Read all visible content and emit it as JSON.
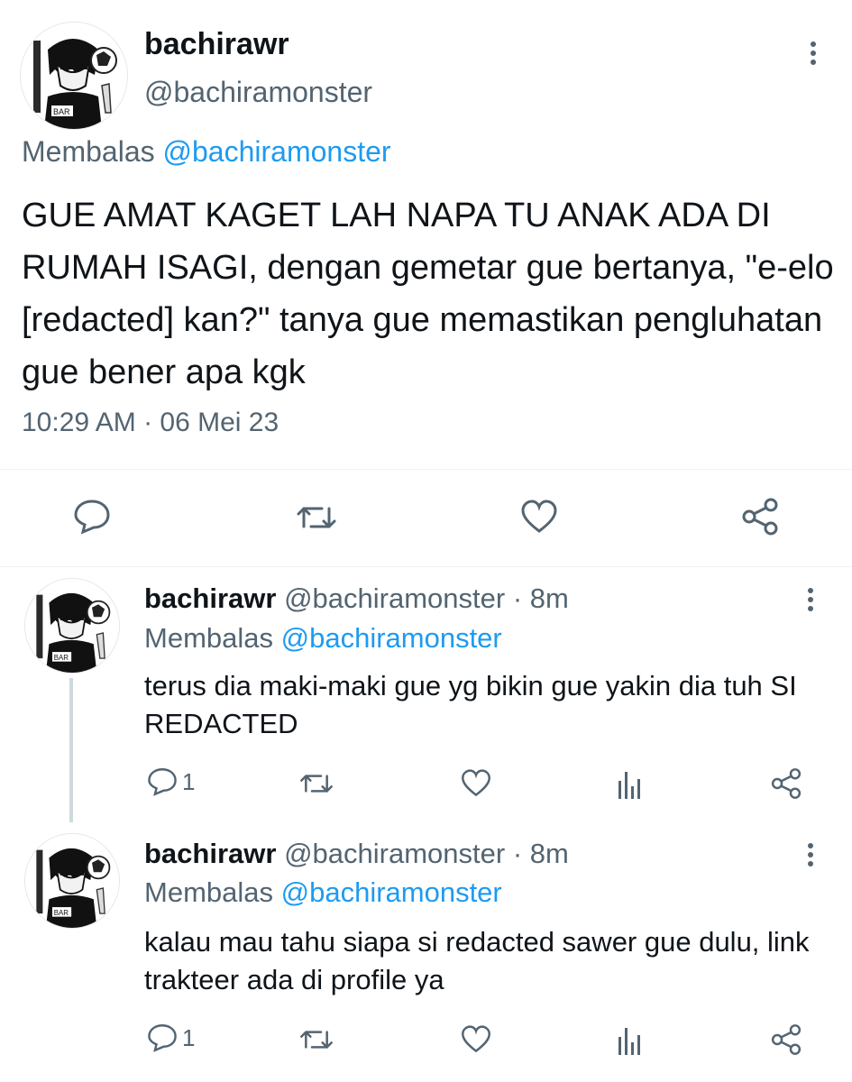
{
  "main_tweet": {
    "display_name": "bachirawr",
    "handle": "@bachiramonster",
    "reply_prefix": "Membalas",
    "reply_to": "@bachiramonster",
    "text": "GUE AMAT KAGET LAH NAPA TU ANAK ADA DI RUMAH ISAGI, dengan gemetar gue bertanya, \"e-elo [redacted] kan?\" tanya gue memastikan pengluhatan gue bener apa kgk",
    "timestamp": "10:29 AM · 06 Mei 23"
  },
  "replies": [
    {
      "display_name": "bachirawr",
      "handle_time": "@bachiramonster · 8m",
      "reply_prefix": "Membalas",
      "reply_to": "@bachiramonster",
      "text": "terus dia maki-maki gue yg bikin gue yakin dia tuh SI REDACTED",
      "reply_count": "1"
    },
    {
      "display_name": "bachirawr",
      "handle_time": "@bachiramonster · 8m",
      "reply_prefix": "Membalas",
      "reply_to": "@bachiramonster",
      "text": "kalau mau tahu siapa si redacted sawer gue dulu, link trakteer ada di profile ya",
      "reply_count": "1"
    }
  ],
  "icons": [
    "reply-icon",
    "retweet-icon",
    "like-icon",
    "share-icon",
    "views-icon",
    "more-icon",
    "avatar"
  ],
  "colors": {
    "accent": "#1d9bf0",
    "muted": "#536471",
    "text": "#0f1419"
  }
}
